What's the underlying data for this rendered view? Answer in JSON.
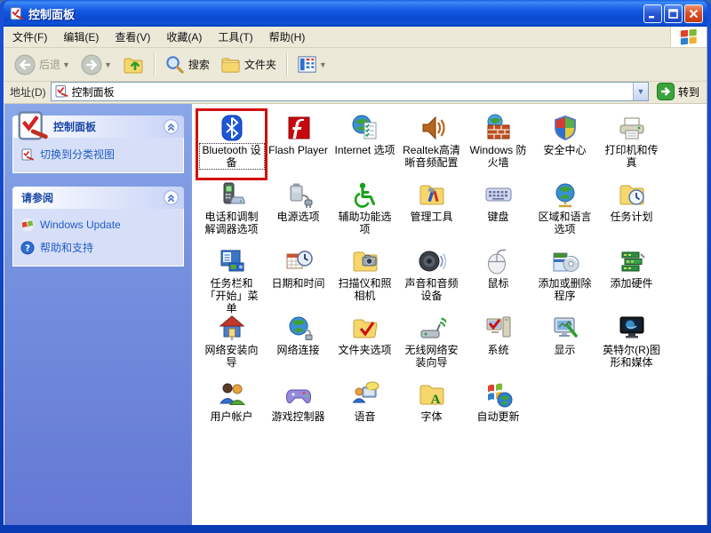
{
  "window": {
    "title": "控制面板",
    "titlebar_buttons": [
      "minimize",
      "maximize",
      "close"
    ]
  },
  "menubar": {
    "items": [
      {
        "label": "文件(F)"
      },
      {
        "label": "编辑(E)"
      },
      {
        "label": "查看(V)"
      },
      {
        "label": "收藏(A)"
      },
      {
        "label": "工具(T)"
      },
      {
        "label": "帮助(H)"
      }
    ],
    "logo_icon": "windows-logo-icon"
  },
  "toolbar": {
    "back_label": "后退",
    "search_label": "搜索",
    "folders_label": "文件夹",
    "buttons": [
      "back",
      "back-dropdown",
      "forward",
      "forward-dropdown",
      "up",
      "search",
      "folders",
      "views",
      "views-dropdown"
    ]
  },
  "addressbar": {
    "label": "地址(D)",
    "value": "控制面板",
    "go_label": "转到"
  },
  "sidebar": {
    "panels": [
      {
        "title": "控制面板",
        "header_icon": "control-panel-icon",
        "items": [
          {
            "label": "切换到分类视图",
            "icon": "category-view-icon"
          }
        ]
      },
      {
        "title": "请参阅",
        "items": [
          {
            "label": "Windows Update",
            "icon": "windows-update-icon"
          },
          {
            "label": "帮助和支持",
            "icon": "help-icon"
          }
        ]
      }
    ]
  },
  "content": {
    "highlight": {
      "target": "Bluetooth 设备",
      "color": "#d40e0e"
    },
    "items": [
      {
        "label": "Bluetooth 设备",
        "icon": "bluetooth-icon",
        "selected": true
      },
      {
        "label": "Flash Player",
        "icon": "flash-player-icon"
      },
      {
        "label": "Internet 选项",
        "icon": "internet-options-icon"
      },
      {
        "label": "Realtek高清晰音频配置",
        "icon": "realtek-audio-icon"
      },
      {
        "label": "Windows 防火墙",
        "icon": "windows-firewall-icon"
      },
      {
        "label": "安全中心",
        "icon": "security-center-icon"
      },
      {
        "label": "打印机和传真",
        "icon": "printers-faxes-icon"
      },
      {
        "label": "电话和调制解调器选项",
        "icon": "phone-modem-icon"
      },
      {
        "label": "电源选项",
        "icon": "power-options-icon"
      },
      {
        "label": "辅助功能选项",
        "icon": "accessibility-icon"
      },
      {
        "label": "管理工具",
        "icon": "admin-tools-icon"
      },
      {
        "label": "键盘",
        "icon": "keyboard-icon"
      },
      {
        "label": "区域和语言选项",
        "icon": "regional-language-icon"
      },
      {
        "label": "任务计划",
        "icon": "scheduled-tasks-icon"
      },
      {
        "label": "任务栏和「开始」菜单",
        "icon": "taskbar-startmenu-icon"
      },
      {
        "label": "日期和时间",
        "icon": "date-time-icon"
      },
      {
        "label": "扫描仪和照相机",
        "icon": "scanners-cameras-icon"
      },
      {
        "label": "声音和音频设备",
        "icon": "sounds-audio-icon"
      },
      {
        "label": "鼠标",
        "icon": "mouse-icon"
      },
      {
        "label": "添加或删除程序",
        "icon": "add-remove-programs-icon"
      },
      {
        "label": "添加硬件",
        "icon": "add-hardware-icon"
      },
      {
        "label": "网络安装向导",
        "icon": "network-setup-icon"
      },
      {
        "label": "网络连接",
        "icon": "network-connections-icon"
      },
      {
        "label": "文件夹选项",
        "icon": "folder-options-icon"
      },
      {
        "label": "无线网络安装向导",
        "icon": "wireless-setup-icon"
      },
      {
        "label": "系统",
        "icon": "system-icon"
      },
      {
        "label": "显示",
        "icon": "display-icon"
      },
      {
        "label": "英特尔(R)图形和媒体",
        "icon": "intel-graphics-icon"
      },
      {
        "label": "用户帐户",
        "icon": "user-accounts-icon"
      },
      {
        "label": "游戏控制器",
        "icon": "game-controllers-icon"
      },
      {
        "label": "语音",
        "icon": "speech-icon"
      },
      {
        "label": "字体",
        "icon": "fonts-icon"
      },
      {
        "label": "自动更新",
        "icon": "auto-updates-icon"
      }
    ]
  }
}
